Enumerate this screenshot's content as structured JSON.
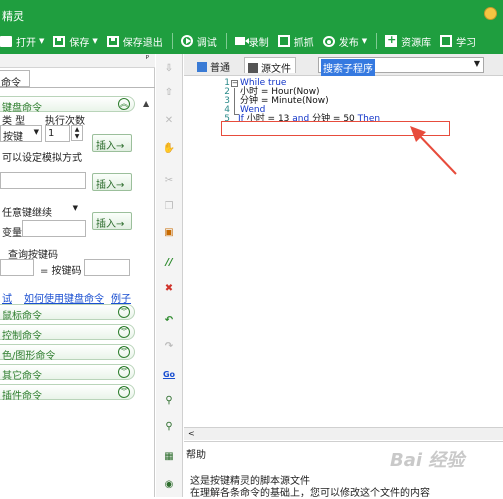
{
  "app": {
    "title": "精灵"
  },
  "toolbar": {
    "items": [
      {
        "label": "打开",
        "icon": "folder-icon",
        "caret": true
      },
      {
        "label": "保存",
        "icon": "save-icon",
        "caret": true
      },
      {
        "label": "保存退出",
        "icon": "save-exit-icon"
      },
      {
        "label": "调试",
        "icon": "play-icon"
      },
      {
        "label": "录制",
        "icon": "record-icon"
      },
      {
        "label": "抓抓",
        "icon": "capture-icon"
      },
      {
        "label": "发布",
        "icon": "publish-icon",
        "caret": true
      },
      {
        "label": "资源库",
        "icon": "resource-icon"
      },
      {
        "label": "学习",
        "icon": "learn-icon"
      }
    ]
  },
  "left_panel": {
    "pin": "ᴾ",
    "tab": "命令",
    "keyboard": {
      "header": "键盘命令",
      "col_type": "类 型",
      "col_count": "执行次数",
      "type_value": "按键",
      "count_value": "1",
      "insert_label": "插入→",
      "hint": "可以设定模拟方式",
      "key_select": "任意键继续",
      "var_label": "变量",
      "query_label": "查询按键码",
      "code_label": "= 按键码"
    },
    "links": [
      "试",
      "如何使用键盘命令",
      "例子"
    ],
    "sections": [
      "鼠标命令",
      "控制命令",
      "色/图形命令",
      "其它命令",
      "插件命令"
    ]
  },
  "editor": {
    "tabs": [
      "普通",
      "源文件"
    ],
    "combo_value": "搜索子程序",
    "line_numbers": [
      "1",
      "2",
      "3",
      "4",
      "5"
    ],
    "code": [
      {
        "kw": "While true",
        "text": ""
      },
      {
        "kw": "",
        "text": "小时 = Hour(Now)"
      },
      {
        "kw": "",
        "text": "分钟 = Minute(Now)"
      },
      {
        "kw": "Wend",
        "text": ""
      },
      {
        "kw": "",
        "text": "If 小时 = 13 and 分钟 = 50 Then"
      }
    ],
    "highlight_color": "#e74c3c"
  },
  "help": {
    "title": "帮助",
    "line1": "这是按键精灵的脚本源文件",
    "line2": "在理解各条命令的基础上，您可以修改这个文件的内容"
  },
  "watermark": "Bai 经验",
  "colors": {
    "brand": "#1f9e3f",
    "link": "#1a4fd1",
    "keyword": "#1336c9"
  }
}
